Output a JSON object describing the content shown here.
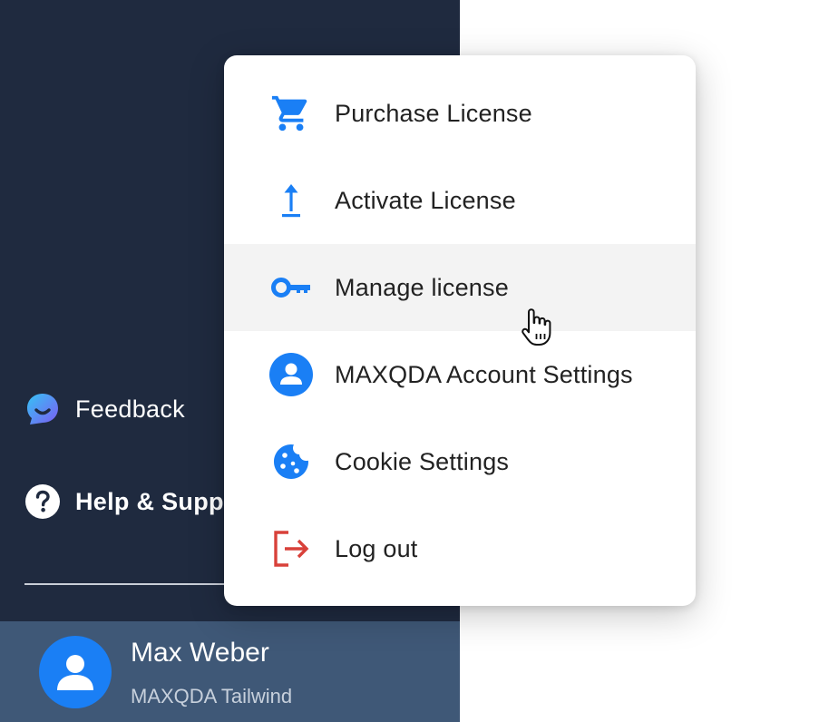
{
  "colors": {
    "sidebar_bg": "#1f2a3f",
    "user_panel_bg": "#3f5877",
    "accent_blue": "#1a7ff5",
    "logout_red": "#d8413a",
    "menu_hover_bg": "#f3f3f3"
  },
  "sidebar": {
    "items": [
      {
        "label": "Feedback",
        "icon": "feedback-chat-icon"
      },
      {
        "label": "Help & Support",
        "icon": "help-question-icon"
      }
    ]
  },
  "user": {
    "name": "Max Weber",
    "organization": "MAXQDA Tailwind",
    "icon": "user-avatar-icon"
  },
  "menu": {
    "items": [
      {
        "label": "Purchase License",
        "icon": "cart-icon"
      },
      {
        "label": "Activate License",
        "icon": "upload-arrow-icon"
      },
      {
        "label": "Manage license",
        "icon": "key-icon",
        "hovered": true
      },
      {
        "label": "MAXQDA Account Settings",
        "icon": "account-icon"
      },
      {
        "label": "Cookie Settings",
        "icon": "cookie-icon"
      },
      {
        "label": "Log out",
        "icon": "logout-icon"
      }
    ]
  }
}
